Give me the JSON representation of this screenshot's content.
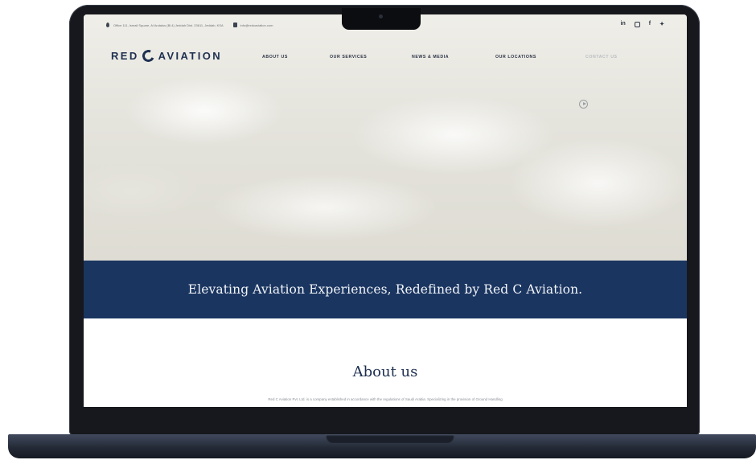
{
  "topbar": {
    "address": "Office 111, Ismail Square, Al Andalus (Bl.4) Jeddah Dist. 23611, Jeddah, KSA",
    "email": "info@redcaviation.com",
    "social_icons": [
      "linkedin-icon",
      "instagram-icon",
      "facebook-icon",
      "twitter-icon"
    ],
    "social": {
      "linkedin": "in",
      "facebook": "f",
      "twitter": "✦"
    }
  },
  "logo": {
    "part1": "RED",
    "part2": "AVIATION"
  },
  "nav": {
    "about": "ABOUT US",
    "services": "OUR SERVICES",
    "news": "NEWS & MEDIA",
    "locations": "OUR LOCATIONS",
    "contact": "CONTACT US"
  },
  "banner": {
    "text": "Elevating Aviation Experiences, Redefined by Red C Aviation."
  },
  "about": {
    "title": "About us",
    "text": "Red C Aviation Pvt. Ltd. is a company established in accordance with the regulations of Saudi Arabia. Specializing in the provision of Ground Handling"
  },
  "colors": {
    "brand_navy": "#1a3560",
    "laptop_frame": "#16181d",
    "hero_sky": "#e8e7e0"
  }
}
